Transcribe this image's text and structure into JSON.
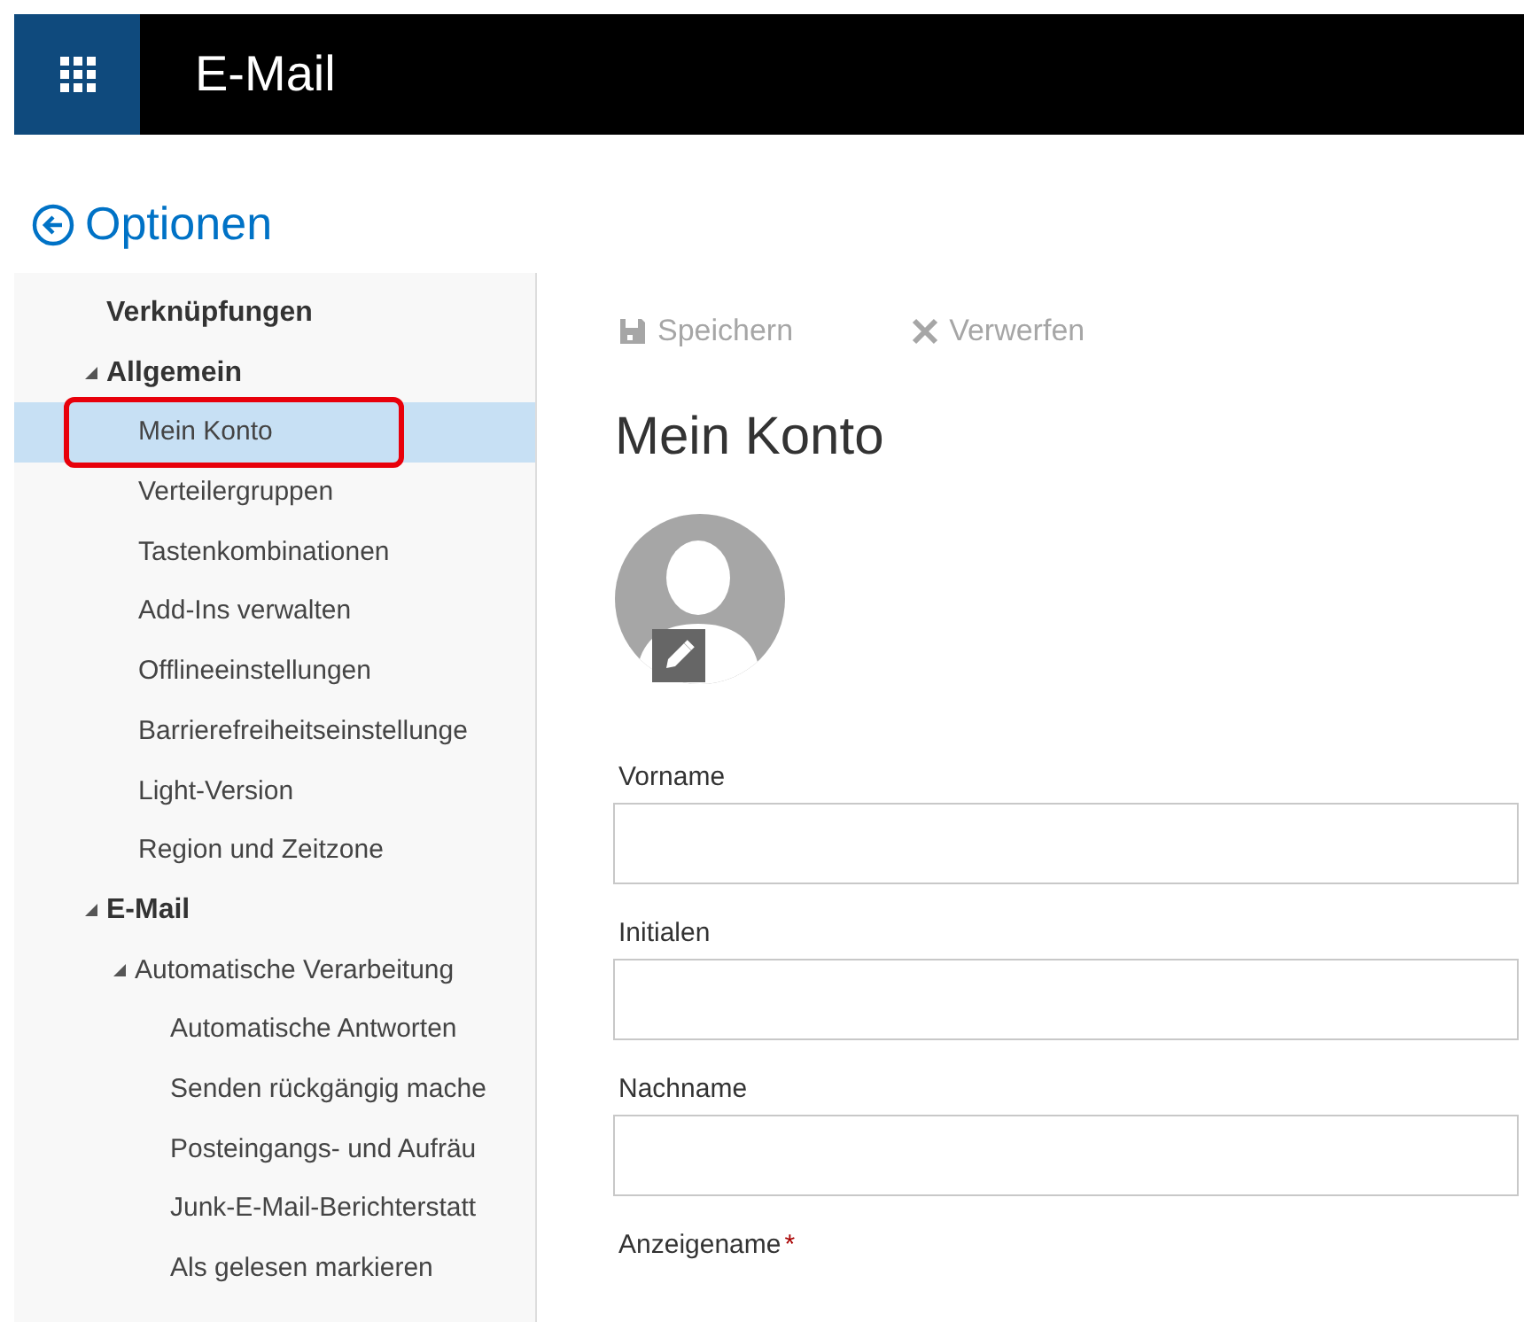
{
  "header": {
    "title": "E-Mail"
  },
  "back": {
    "label": "Optionen"
  },
  "sidebar": {
    "items": [
      {
        "label": "Verknüpfungen",
        "selected": false
      },
      {
        "label": "Allgemein",
        "selected": false,
        "expanded": true,
        "children": [
          {
            "label": "Mein Konto",
            "selected": true,
            "highlighted": true
          },
          {
            "label": "Verteilergruppen",
            "selected": false
          },
          {
            "label": "Tastenkombinationen",
            "selected": false
          },
          {
            "label": "Add-Ins verwalten",
            "selected": false
          },
          {
            "label": "Offlineeinstellungen",
            "selected": false
          },
          {
            "label": "Barrierefreiheitseinstellunge",
            "selected": false
          },
          {
            "label": "Light-Version",
            "selected": false
          },
          {
            "label": "Region und Zeitzone",
            "selected": false
          }
        ]
      },
      {
        "label": "E-Mail",
        "selected": false,
        "expanded": true,
        "children": [
          {
            "label": "Automatische Verarbeitung",
            "selected": false,
            "expanded": true,
            "children": [
              {
                "label": "Automatische Antworten",
                "selected": false
              },
              {
                "label": "Senden rückgängig mache",
                "selected": false
              },
              {
                "label": "Posteingangs- und Aufräu",
                "selected": false
              },
              {
                "label": "Junk-E-Mail-Berichterstatt",
                "selected": false
              },
              {
                "label": "Als gelesen markieren",
                "selected": false
              }
            ]
          }
        ]
      }
    ]
  },
  "toolbar": [
    {
      "kind": "save",
      "label": "Speichern",
      "disabled": true
    },
    {
      "kind": "discard",
      "label": "Verwerfen",
      "disabled": true
    }
  ],
  "page_title": "Mein Konto",
  "fields": [
    {
      "kind": "input",
      "label": "Vorname"
    },
    {
      "kind": "input",
      "label": "Initialen"
    },
    {
      "kind": "input",
      "label": "Nachname"
    },
    {
      "kind": "label",
      "label": "Anzeigename",
      "required_mark": "*"
    }
  ]
}
